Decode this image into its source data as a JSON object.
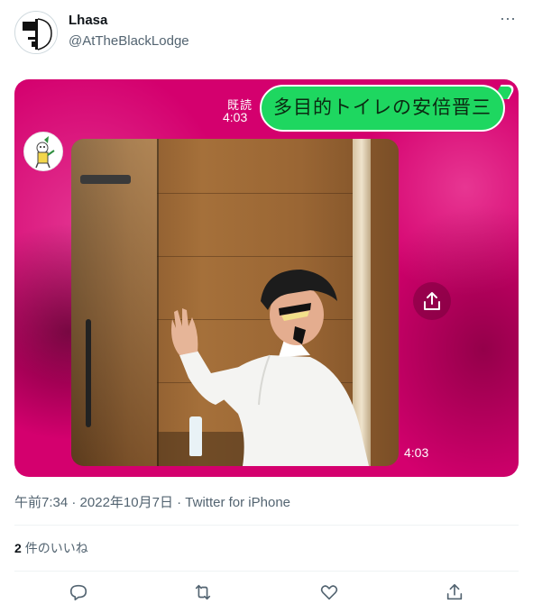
{
  "author": {
    "display_name": "Lhasa",
    "handle": "@AtTheBlackLodge"
  },
  "header": {
    "more_label": "···"
  },
  "media": {
    "read_label": "既読",
    "read_time": "4:03",
    "bubble_text": "多目的トイレの安倍晋三",
    "video_time": "4:03"
  },
  "meta": {
    "time": "午前7:34",
    "date": "2022年10月7日",
    "source": "Twitter for iPhone",
    "separator": " · "
  },
  "likes": {
    "count": "2",
    "label": "件のいいね"
  },
  "actions": [
    {
      "name": "reply",
      "icon": "reply-icon"
    },
    {
      "name": "retweet",
      "icon": "retweet-icon"
    },
    {
      "name": "like",
      "icon": "heart-icon"
    },
    {
      "name": "share",
      "icon": "share-icon"
    }
  ],
  "colors": {
    "media_background": "#d4006e",
    "bubble": "#1ed760",
    "secondary_text": "#536471"
  }
}
